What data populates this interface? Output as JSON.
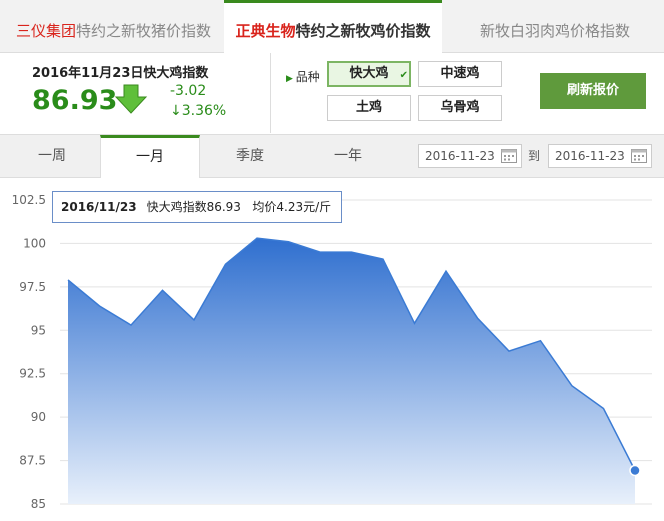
{
  "tabs": [
    {
      "brand": "三仪集团",
      "label": "特约之新牧猪价指数"
    },
    {
      "brand": "正典生物",
      "label": "特约之新牧鸡价指数"
    },
    {
      "brand": "",
      "label": "新牧白羽肉鸡价格指数"
    }
  ],
  "index": {
    "title": "2016年11月23日快大鸡指数",
    "value": "86.93",
    "change": "-3.02",
    "change_pct": "↓3.36%"
  },
  "variety": {
    "label": "品种",
    "options": [
      "快大鸡",
      "中速鸡",
      "土鸡",
      "乌骨鸡"
    ],
    "selected": "快大鸡"
  },
  "refresh_label": "刷新报价",
  "periods": [
    "一周",
    "一月",
    "季度",
    "一年"
  ],
  "active_period": "一月",
  "date_range": {
    "from": "2016-11-23",
    "to_label": "到",
    "to": "2016-11-23"
  },
  "tooltip": {
    "date": "2016/11/23",
    "index_text": "快大鸡指数86.93",
    "avg_text": "均价4.23元/斤"
  },
  "colors": {
    "accent_green": "#2a8c1a",
    "brand_red": "#d9241c",
    "line_blue": "#3b7bd4"
  },
  "chart_data": {
    "type": "area",
    "title": "",
    "xlabel": "",
    "ylabel": "",
    "y_ticks": [
      "102.5",
      "100",
      "97.5",
      "95",
      "92.5",
      "90",
      "87.5",
      "85"
    ],
    "ylim": [
      85,
      102.5
    ],
    "grid": true,
    "values": [
      97.9,
      96.4,
      95.3,
      97.3,
      95.6,
      98.8,
      100.3,
      100.1,
      99.5,
      99.5,
      99.1,
      95.4,
      98.4,
      95.7,
      93.8,
      94.4,
      91.8,
      90.5,
      86.93
    ]
  }
}
